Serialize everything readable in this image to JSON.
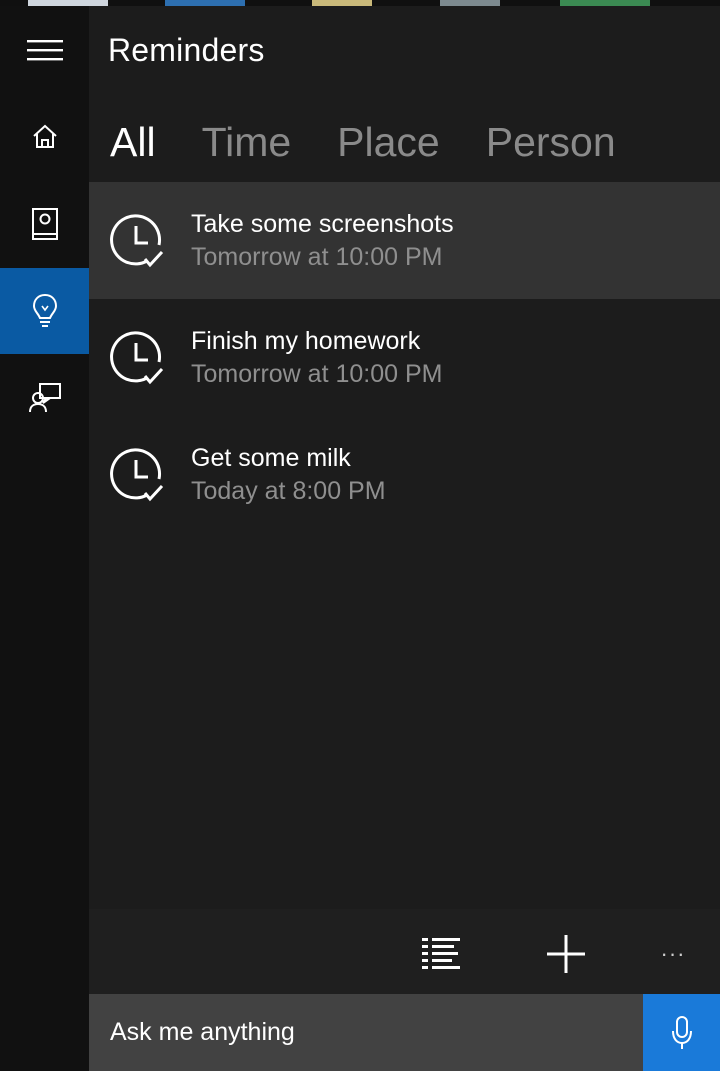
{
  "app": {
    "title": "Reminders"
  },
  "nav": {
    "items": [
      {
        "name": "home",
        "icon": "home-icon",
        "active": false
      },
      {
        "name": "notebook",
        "icon": "notebook-icon",
        "active": false
      },
      {
        "name": "reminders",
        "icon": "lightbulb-icon",
        "active": true
      },
      {
        "name": "feedback",
        "icon": "feedback-icon",
        "active": false
      }
    ]
  },
  "tabs": [
    {
      "label": "All",
      "selected": true
    },
    {
      "label": "Time",
      "selected": false
    },
    {
      "label": "Place",
      "selected": false
    },
    {
      "label": "Person",
      "selected": false
    }
  ],
  "reminders": [
    {
      "title": "Take some screenshots",
      "when": "Tomorrow at 10:00 PM",
      "icon": "clock-check-icon"
    },
    {
      "title": "Finish my homework",
      "when": "Tomorrow at 10:00 PM",
      "icon": "clock-check-icon"
    },
    {
      "title": "Get some milk",
      "when": "Today at 8:00 PM",
      "icon": "clock-check-icon"
    }
  ],
  "toolbar": {
    "buttons": [
      {
        "name": "list-view",
        "icon": "list-icon"
      },
      {
        "name": "add-reminder",
        "icon": "plus-icon"
      },
      {
        "name": "more",
        "icon": "more-icon",
        "label": "···"
      }
    ]
  },
  "search": {
    "placeholder": "Ask me anything",
    "mic_icon": "microphone-icon"
  },
  "colors": {
    "accent": "#0a5aa3",
    "mic": "#1a7ad9",
    "highlight": "#333333",
    "inactive_text": "#8a8a8a"
  }
}
